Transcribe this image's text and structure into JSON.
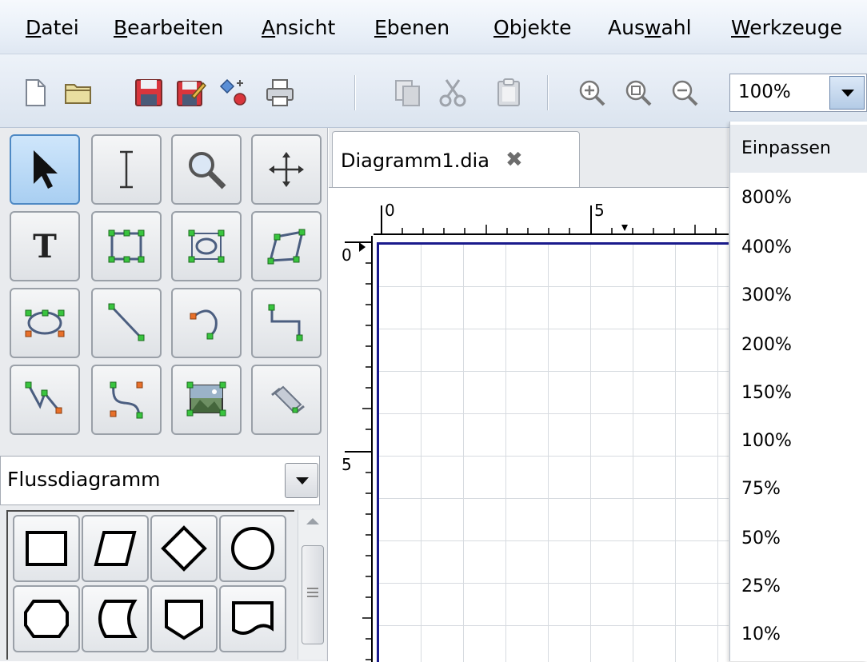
{
  "menubar": {
    "items": [
      {
        "mnemonic": "D",
        "rest": "atei"
      },
      {
        "mnemonic": "B",
        "rest": "earbeiten"
      },
      {
        "mnemonic": "A",
        "rest": "nsicht"
      },
      {
        "mnemonic": "E",
        "rest": "benen"
      },
      {
        "mnemonic": "O",
        "rest": "bjekte"
      },
      {
        "pre": "Aus",
        "mnemonic": "w",
        "rest": "ahl"
      },
      {
        "mnemonic": "W",
        "rest": "erkzeuge"
      }
    ]
  },
  "toolbar": {
    "buttons": [
      "new-icon",
      "open-icon",
      "save-icon",
      "save-as-icon",
      "export-icon",
      "print-icon",
      "copy-icon",
      "cut-icon",
      "paste-icon",
      "zoom-in-icon",
      "zoom-fit-icon",
      "zoom-out-icon"
    ],
    "zoom_value": "100%"
  },
  "toolbox": {
    "tools": [
      "select-pointer-icon",
      "text-cursor-icon",
      "magnify-icon",
      "move-icon",
      "text-tool-icon",
      "box-icon",
      "ellipse-box-icon",
      "polygon-icon",
      "ellipse-icon",
      "line-icon",
      "arc-icon",
      "zigzag-line-icon",
      "polyline-icon",
      "bezier-icon",
      "image-icon",
      "outline-icon"
    ],
    "sheet_selected": "Flussdiagramm"
  },
  "document": {
    "tab_title": "Diagramm1.dia",
    "hruler_labels": [
      "0",
      "5"
    ],
    "vruler_labels": [
      "0",
      "5"
    ]
  },
  "zoom_dropdown": {
    "options": [
      "Einpassen",
      "800%",
      "400%",
      "300%",
      "200%",
      "150%",
      "100%",
      "75%",
      "50%",
      "25%",
      "10%"
    ]
  },
  "colors": {
    "menubar_bg": "#e7eef7",
    "active_tool": "#a9cff2",
    "page_border": "#1a1a8c"
  }
}
